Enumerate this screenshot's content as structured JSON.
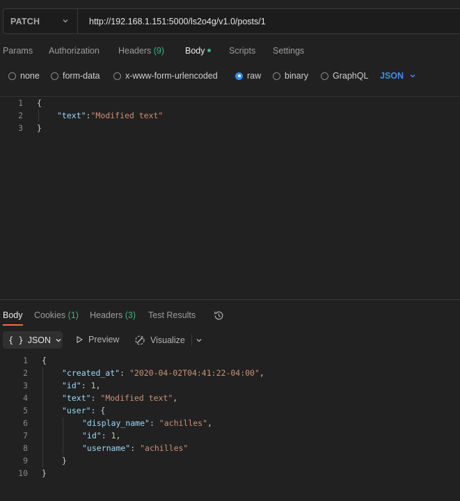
{
  "request": {
    "method": "PATCH",
    "url": "http://192.168.1.151:5000/ls2o4g/v1.0/posts/1"
  },
  "request_tabs": {
    "params": "Params",
    "authorization": "Authorization",
    "headers": "Headers",
    "headers_count": "(9)",
    "body": "Body",
    "scripts": "Scripts",
    "settings": "Settings",
    "active": "Body"
  },
  "body_types": {
    "none": "none",
    "form_data": "form-data",
    "urlencoded": "x-www-form-urlencoded",
    "raw": "raw",
    "binary": "binary",
    "graphql": "GraphQL",
    "selected": "raw",
    "format": "JSON"
  },
  "request_body": {
    "line_numbers": [
      "1",
      "2",
      "3"
    ],
    "open": "{",
    "key": "\"text\"",
    "colon": ":",
    "value": "\"Modified text\"",
    "close": "}"
  },
  "response_tabs": {
    "body": "Body",
    "cookies": "Cookies",
    "cookies_count": "(1)",
    "headers": "Headers",
    "headers_count": "(3)",
    "test_results": "Test Results",
    "active": "Body"
  },
  "response_toolbar": {
    "format": "JSON",
    "preview": "Preview",
    "visualize": "Visualize"
  },
  "response_body": {
    "line_numbers": [
      "1",
      "2",
      "3",
      "4",
      "5",
      "6",
      "7",
      "8",
      "9",
      "10"
    ],
    "created_at_key": "\"created_at\"",
    "created_at_value": "\"2020-04-02T04:41:22-04:00\"",
    "id_key": "\"id\"",
    "id_value": "1",
    "text_key": "\"text\"",
    "text_value": "\"Modified text\"",
    "user_key": "\"user\"",
    "display_name_key": "\"display_name\"",
    "display_name_value": "\"achilles\"",
    "user_id_key": "\"id\"",
    "user_id_value": "1",
    "username_key": "\"username\"",
    "username_value": "\"achilles\""
  },
  "colors": {
    "accent": "#ff6c37",
    "radio_selected": "#2f8cf0",
    "count_green": "#3fb37f",
    "json_key": "#9cdcfe",
    "json_string": "#ce9178",
    "json_number": "#b5cea8"
  }
}
